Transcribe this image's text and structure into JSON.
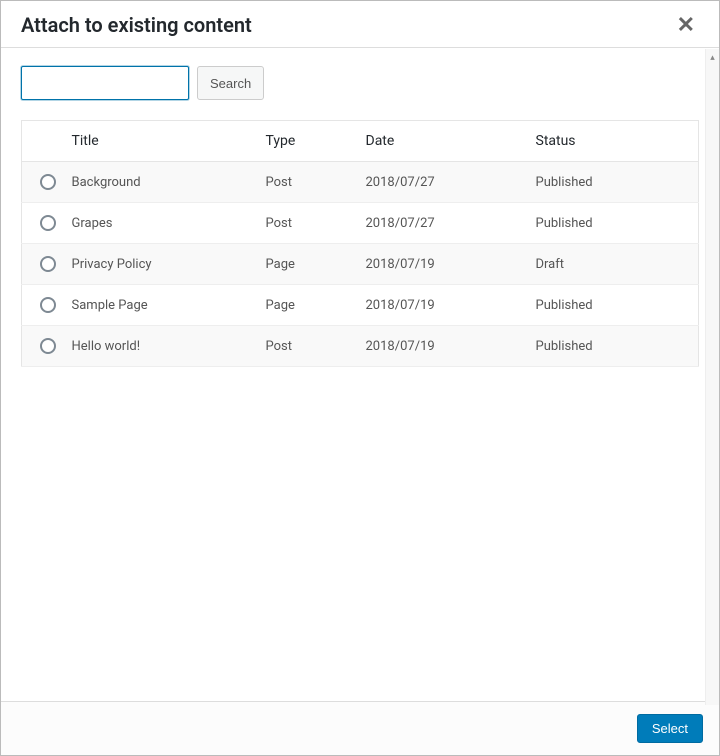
{
  "header": {
    "title": "Attach to existing content"
  },
  "search": {
    "value": "",
    "button_label": "Search"
  },
  "table": {
    "headers": {
      "title": "Title",
      "type": "Type",
      "date": "Date",
      "status": "Status"
    },
    "rows": [
      {
        "title": "Background",
        "type": "Post",
        "date": "2018/07/27",
        "status": "Published"
      },
      {
        "title": "Grapes",
        "type": "Post",
        "date": "2018/07/27",
        "status": "Published"
      },
      {
        "title": "Privacy Policy",
        "type": "Page",
        "date": "2018/07/19",
        "status": "Draft"
      },
      {
        "title": "Sample Page",
        "type": "Page",
        "date": "2018/07/19",
        "status": "Published"
      },
      {
        "title": "Hello world!",
        "type": "Post",
        "date": "2018/07/19",
        "status": "Published"
      }
    ]
  },
  "footer": {
    "select_label": "Select"
  }
}
